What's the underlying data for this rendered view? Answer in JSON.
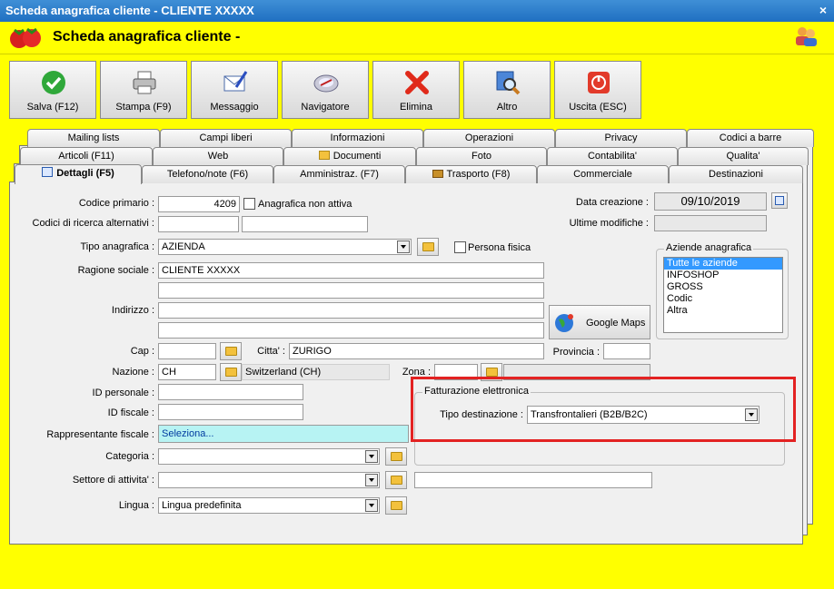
{
  "window": {
    "title": "Scheda anagrafica cliente - CLIENTE XXXXX",
    "close": "×"
  },
  "header": {
    "title": "Scheda anagrafica cliente -"
  },
  "toolbar": [
    {
      "label": "Salva (F12)",
      "icon": "check-icon"
    },
    {
      "label": "Stampa (F9)",
      "icon": "printer-icon"
    },
    {
      "label": "Messaggio",
      "icon": "message-icon"
    },
    {
      "label": "Navigatore",
      "icon": "compass-icon"
    },
    {
      "label": "Elimina",
      "icon": "delete-icon"
    },
    {
      "label": "Altro",
      "icon": "search-icon"
    },
    {
      "label": "Uscita (ESC)",
      "icon": "exit-icon"
    }
  ],
  "tabs": {
    "row1": [
      "Mailing lists",
      "Campi liberi",
      "Informazioni",
      "Operazioni",
      "Privacy",
      "Codici a barre"
    ],
    "row2": [
      "Articoli (F11)",
      "Web",
      "Documenti",
      "Foto",
      "Contabilita'",
      "Qualita'"
    ],
    "row3": [
      "Dettagli (F5)",
      "Telefono/note (F6)",
      "Amministraz. (F7)",
      "Trasporto (F8)",
      "Commerciale",
      "Destinazioni"
    ]
  },
  "form": {
    "codice_primario_label": "Codice primario :",
    "codice_primario_value": "4209",
    "anagrafica_non_attiva": "Anagrafica non attiva",
    "codici_alt_label": "Codici di ricerca alternativi :",
    "tipo_anagrafica_label": "Tipo anagrafica :",
    "tipo_anagrafica_value": "AZIENDA",
    "persona_fisica": "Persona fisica",
    "ragione_sociale_label": "Ragione sociale :",
    "ragione_sociale_value": "CLIENTE XXXXX",
    "indirizzo_label": "Indirizzo :",
    "cap_label": "Cap :",
    "citta_label": "Citta' :",
    "citta_value": "ZURIGO",
    "provincia_label": "Provincia :",
    "nazione_label": "Nazione :",
    "nazione_value": "CH",
    "nazione_name": "Switzerland (CH)",
    "zona_label": "Zona :",
    "id_personale_label": "ID personale :",
    "id_fiscale_label": "ID fiscale :",
    "rappresentante_label": "Rappresentante fiscale :",
    "rappresentante_value": "Seleziona...",
    "categoria_label": "Categoria :",
    "settore_label": "Settore di attivita' :",
    "lingua_label": "Lingua :",
    "lingua_value": "Lingua predefinita",
    "data_creazione_label": "Data creazione :",
    "data_creazione_value": "09/10/2019",
    "ultime_modifiche_label": "Ultime modifiche :",
    "google_maps": "Google Maps"
  },
  "aziende": {
    "caption": "Aziende anagrafica",
    "items": [
      "Tutte le aziende",
      "INFOSHOP",
      "GROSS",
      "Codic",
      "Altra"
    ],
    "selected_index": 0
  },
  "fatturazione": {
    "caption": "Fatturazione elettronica",
    "tipo_label": "Tipo destinazione :",
    "tipo_value": "Transfrontalieri (B2B/B2C)"
  },
  "colors": {
    "background": "#ffff00",
    "titlebar": "#2a7ccb",
    "highlight": "#e32222",
    "selection": "#3399ff"
  }
}
